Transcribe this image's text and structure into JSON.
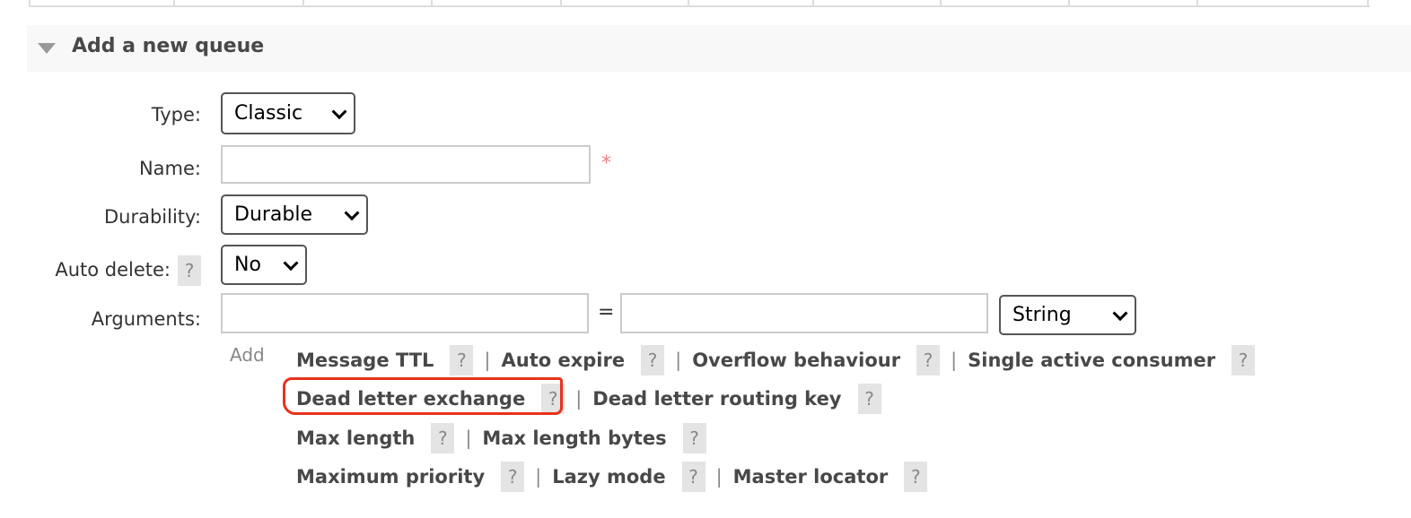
{
  "section": {
    "title": "Add a new queue",
    "toggle_icon": "triangle-down-icon"
  },
  "form": {
    "type": {
      "label": "Type:",
      "value": "Classic"
    },
    "name": {
      "label": "Name:",
      "value": "",
      "required_marker": "*"
    },
    "durability": {
      "label": "Durability:",
      "value": "Durable"
    },
    "auto_delete": {
      "label": "Auto delete:",
      "help": "?",
      "value": "No"
    },
    "arguments": {
      "label": "Arguments:",
      "key": "",
      "equals": "=",
      "value": "",
      "type": "String"
    }
  },
  "add_label": "Add",
  "arg_rows": [
    [
      {
        "label": "Message TTL",
        "help": "?"
      },
      {
        "label": "Auto expire",
        "help": "?"
      },
      {
        "label": "Overflow behaviour",
        "help": "?"
      },
      {
        "label": "Single active consumer",
        "help": "?"
      }
    ],
    [
      {
        "label": "Dead letter exchange",
        "help": "?"
      },
      {
        "label": "Dead letter routing key",
        "help": "?"
      }
    ],
    [
      {
        "label": "Max length",
        "help": "?"
      },
      {
        "label": "Max length bytes",
        "help": "?"
      }
    ],
    [
      {
        "label": "Maximum priority",
        "help": "?"
      },
      {
        "label": "Lazy mode",
        "help": "?"
      },
      {
        "label": "Master locator",
        "help": "?"
      }
    ]
  ],
  "separator": "|",
  "colors": {
    "annotation": "#e8321c",
    "required": "#f08080",
    "help_bg": "#e4e4e4"
  }
}
